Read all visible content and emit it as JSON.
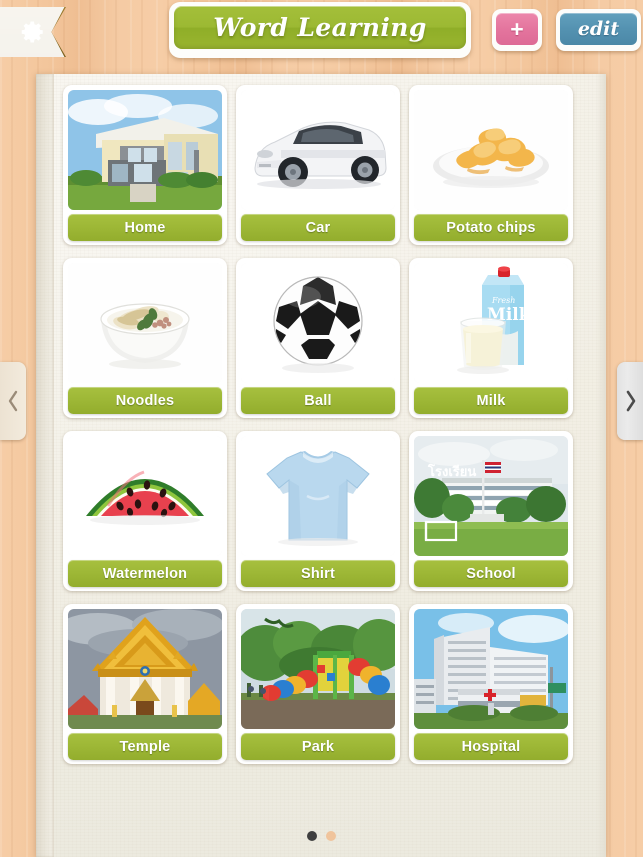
{
  "header": {
    "title": "Word Learning",
    "settings_icon": "gear-icon",
    "add_label": "+",
    "edit_label": "edit"
  },
  "nav": {
    "prev_icon": "chevron-left-icon",
    "prev_label": "<",
    "next_icon": "chevron-right-icon",
    "next_label": ">"
  },
  "pager": {
    "active_index": 0,
    "total": 2,
    "active_color": "#3f3f3f",
    "inactive_color": "#f0c49c"
  },
  "theme": {
    "label_green": "#9db736",
    "title_green": "#9cb933",
    "add_pink": "#e4759e",
    "edit_blue": "#5492b1",
    "ribbon_brown": "#866a22",
    "background_peach": "#f2c49a",
    "panel_cream": "#f1eee3"
  },
  "cards": [
    {
      "label": "Home",
      "image": "two-story-house-photo"
    },
    {
      "label": "Car",
      "image": "white-suv-photo"
    },
    {
      "label": "Potato chips",
      "image": "potato-chips-on-plate-photo"
    },
    {
      "label": "Noodles",
      "image": "noodle-bowl-photo"
    },
    {
      "label": "Ball",
      "image": "soccer-ball-photo"
    },
    {
      "label": "Milk",
      "image": "milk-carton-and-glass-photo"
    },
    {
      "label": "Watermelon",
      "image": "watermelon-slice-photo"
    },
    {
      "label": "Shirt",
      "image": "light-blue-tshirt-photo"
    },
    {
      "label": "School",
      "image": "school-building-photo"
    },
    {
      "label": "Temple",
      "image": "thai-temple-photo"
    },
    {
      "label": "Park",
      "image": "playground-park-photo"
    },
    {
      "label": "Hospital",
      "image": "hospital-building-photo"
    }
  ],
  "image_text": {
    "milk_brand": "Fresh",
    "milk_word": "Milk",
    "school_sign": "โรงเรียน"
  }
}
